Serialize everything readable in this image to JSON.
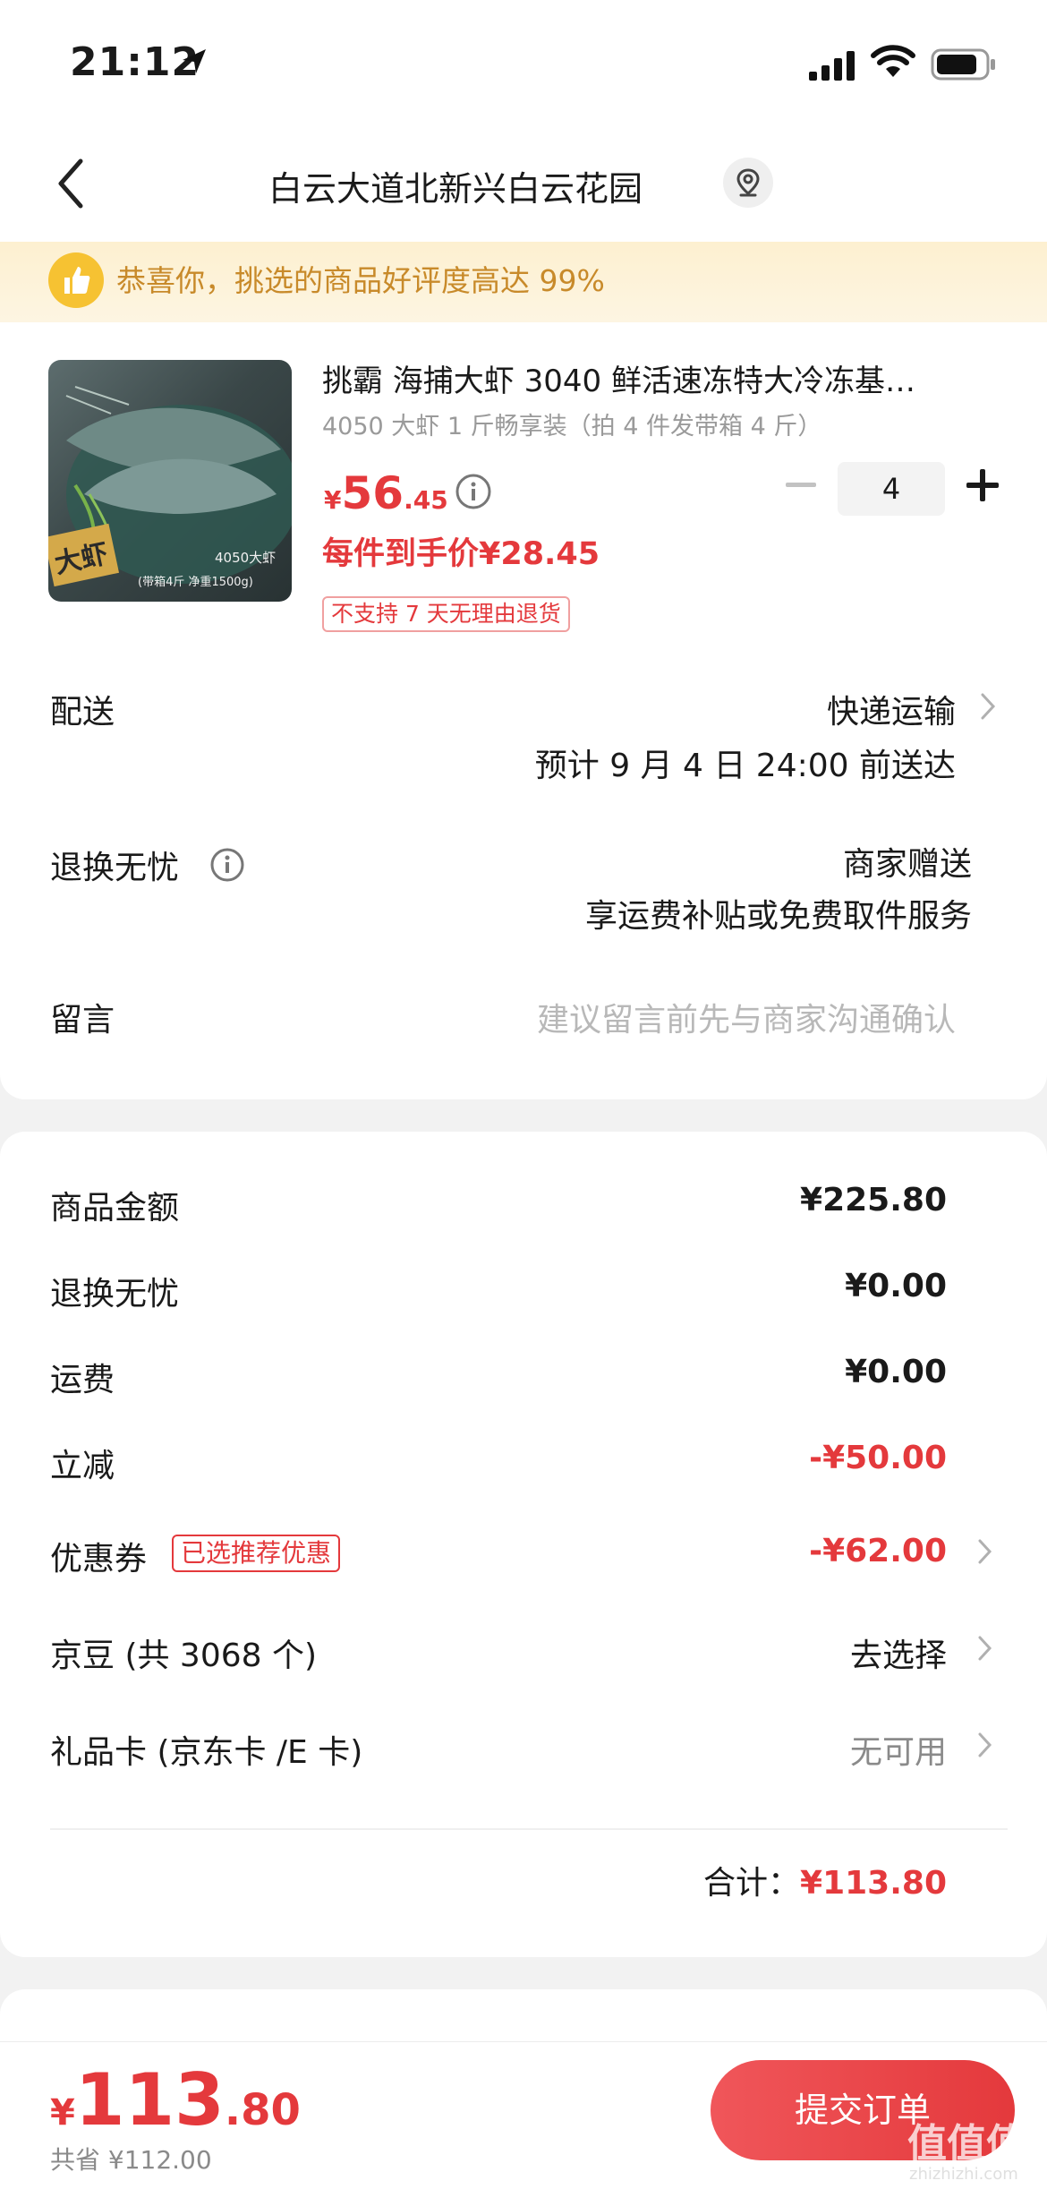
{
  "status_bar": {
    "time": "21:12"
  },
  "nav": {
    "title": "白云大道北新兴白云花园"
  },
  "banner": {
    "text": "恭喜你，挑选的商品好评度高达 99%"
  },
  "product": {
    "title": "挑霸 海捕大虾 3040 鲜活速冻特大冷冻基…",
    "spec": "4050 大虾 1 斤畅享装（拍 4 件发带箱 4 斤）",
    "price_symbol": "¥",
    "price_int": "56",
    "price_dec": ".45",
    "quantity": "4",
    "unit_price": "每件到手价¥28.45",
    "return_tag": "不支持 7 天无理由退货",
    "image_badge": "大虾",
    "image_caption1": "4050大虾",
    "image_caption2": "(带箱4斤  净重1500g)"
  },
  "delivery": {
    "label": "配送",
    "method": "快递运输",
    "eta": "预计 9 月 4 日 24:00 前送达"
  },
  "worry_free": {
    "label": "退换无忧",
    "value": "商家赠送",
    "desc": "享运费补贴或免费取件服务"
  },
  "message": {
    "label": "留言",
    "placeholder": "建议留言前先与商家沟通确认"
  },
  "summary": {
    "goods_amount_label": "商品金额",
    "goods_amount": "¥225.80",
    "worry_free_label": "退换无忧",
    "worry_free_amount": "¥0.00",
    "shipping_label": "运费",
    "shipping_amount": "¥0.00",
    "discount_label": "立减",
    "discount_amount": "-¥50.00",
    "coupon_label": "优惠券",
    "coupon_tag": "已选推荐优惠",
    "coupon_amount": "-¥62.00",
    "jingdou_label": "京豆 (共 3068 个)",
    "jingdou_value": "去选择",
    "giftcard_label": "礼品卡 (京东卡 /E 卡)",
    "giftcard_value": "无可用",
    "total_label": "合计：",
    "total_amount": "¥113.80"
  },
  "bottom": {
    "symbol": "¥",
    "total_int": "113",
    "total_dec": ".80",
    "saved": "共省 ¥112.00",
    "submit_label": "提交订单"
  },
  "watermark": {
    "text": "值值值",
    "sub": "zhizhizhi.com"
  },
  "colors": {
    "accent_red": "#e4393c",
    "banner_bg": "#fdf0d0",
    "banner_text": "#c88a2a"
  }
}
